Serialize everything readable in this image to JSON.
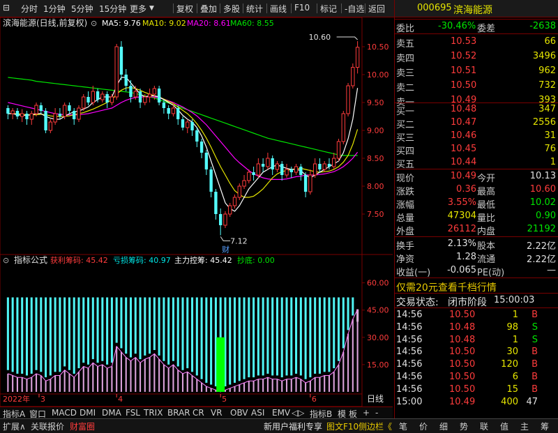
{
  "toolbar": {
    "left_items": [
      "分时",
      "1分钟",
      "5分钟",
      "15分钟",
      "更多"
    ],
    "right_items": [
      "复权",
      "叠加",
      "多股",
      "统计",
      "画线",
      "F10",
      "标记",
      "-自选",
      "返回"
    ]
  },
  "chart": {
    "title": "滨海能源(日线,前复权)",
    "ma": [
      {
        "label": "MA5: 9.76",
        "color": "#ffffff"
      },
      {
        "label": "MA10: 9.02",
        "color": "#e6e600"
      },
      {
        "label": "MA20: 8.61",
        "color": "#ff00ff"
      },
      {
        "label": "MA60: 8.55",
        "color": "#00e600"
      }
    ],
    "price_ticks": [
      "10.50",
      "10.00",
      "9.50",
      "9.00",
      "8.50",
      "8.00",
      "7.50"
    ],
    "high_label": "10.60",
    "low_label": "7.12",
    "low_marker": "财",
    "colors": {
      "up": "#ff3c3c",
      "down": "#54fcfc",
      "ma5": "#ffffff",
      "ma10": "#e6e600",
      "ma20": "#ff00ff",
      "ma60": "#00e600"
    }
  },
  "indicator": {
    "name": "指标公式",
    "items": [
      {
        "label": "获利筹码: 45.42",
        "color": "#ff3c3c"
      },
      {
        "label": "亏损筹码: 40.97",
        "color": "#00e6e6"
      },
      {
        "label": "主力控筹: 45.42",
        "color": "#ffffff"
      },
      {
        "label": "抄底: 0.00",
        "color": "#00e600"
      }
    ],
    "ticks": [
      "60.00",
      "45.00",
      "30.00",
      "15.00"
    ]
  },
  "axis": {
    "year": "2022年",
    "months": [
      "3",
      "4",
      "5",
      "6"
    ],
    "period": "日线"
  },
  "indicator_tabs": [
    "指标A",
    "窗口",
    "MACD",
    "DMI",
    "DMA",
    "FSL",
    "TRIX",
    "BRAR",
    "CR",
    "VR",
    "OBV",
    "ASI",
    "EMV",
    "◁▷",
    "指标B",
    "模",
    "板",
    "+",
    "-"
  ],
  "stock": {
    "code": "000695",
    "name": "滨海能源"
  },
  "weibi": {
    "label": "委比",
    "value": "-30.46%",
    "label2": "委差",
    "value2": "-2638"
  },
  "asks": [
    {
      "label": "卖五",
      "price": "10.53",
      "vol": "66"
    },
    {
      "label": "卖四",
      "price": "10.52",
      "vol": "3496"
    },
    {
      "label": "卖三",
      "price": "10.51",
      "vol": "962"
    },
    {
      "label": "卖二",
      "price": "10.50",
      "vol": "732"
    },
    {
      "label": "卖一",
      "price": "10.49",
      "vol": "393"
    }
  ],
  "bids": [
    {
      "label": "买一",
      "price": "10.48",
      "vol": "347"
    },
    {
      "label": "买二",
      "price": "10.47",
      "vol": "2556"
    },
    {
      "label": "买三",
      "price": "10.46",
      "vol": "31"
    },
    {
      "label": "买四",
      "price": "10.45",
      "vol": "76"
    },
    {
      "label": "买五",
      "price": "10.44",
      "vol": "1"
    }
  ],
  "quote": [
    {
      "l1": "现价",
      "v1": "10.49",
      "c1": "red",
      "l2": "今开",
      "v2": "10.13",
      "c2": "white"
    },
    {
      "l1": "涨跌",
      "v1": "0.36",
      "c1": "red",
      "l2": "最高",
      "v2": "10.60",
      "c2": "red"
    },
    {
      "l1": "涨幅",
      "v1": "3.55%",
      "c1": "red",
      "l2": "最低",
      "v2": "10.02",
      "c2": "green"
    },
    {
      "l1": "总量",
      "v1": "47304",
      "c1": "yellow",
      "l2": "量比",
      "v2": "0.90",
      "c2": "green"
    },
    {
      "l1": "外盘",
      "v1": "26112",
      "c1": "red",
      "l2": "内盘",
      "v2": "21192",
      "c2": "green"
    }
  ],
  "stats": [
    {
      "l1": "换手",
      "v1": "2.13%",
      "l2": "股本",
      "v2": "2.22亿"
    },
    {
      "l1": "净资",
      "v1": "1.28",
      "l2": "流通",
      "v2": "2.22亿"
    },
    {
      "l1": "收益(一)",
      "v1": "-0.065",
      "l2": "PE(动)",
      "v2": "—"
    }
  ],
  "promo": "仅需20元查看千档行情",
  "trade_status": {
    "label": "交易状态:",
    "status": "闭市阶段",
    "time": "15:00:03"
  },
  "ticks_list": [
    {
      "t": "14:56",
      "p": "10.50",
      "v": "1",
      "s": "B"
    },
    {
      "t": "14:56",
      "p": "10.48",
      "v": "98",
      "s": "S"
    },
    {
      "t": "14:56",
      "p": "10.48",
      "v": "1",
      "s": "S"
    },
    {
      "t": "14:56",
      "p": "10.50",
      "v": "30",
      "s": "B"
    },
    {
      "t": "14:56",
      "p": "10.50",
      "v": "120",
      "s": "B"
    },
    {
      "t": "14:56",
      "p": "10.50",
      "v": "6",
      "s": "B"
    },
    {
      "t": "14:56",
      "p": "10.50",
      "v": "15",
      "s": "B"
    },
    {
      "t": "15:00",
      "p": "10.49",
      "v": "400",
      "s": "47"
    }
  ],
  "bottom": {
    "left": [
      "扩展∧",
      "关联报价",
      "财富圈"
    ],
    "middle": [
      "新用户福利专享",
      "图文F10",
      "侧边栏《"
    ],
    "right": [
      "笔",
      "价",
      "细",
      "势",
      "联",
      "值",
      "主",
      "筹"
    ]
  },
  "series": {
    "candles": [
      [
        9.4,
        9.3,
        9.45,
        9.2
      ],
      [
        9.3,
        9.35,
        9.4,
        9.2
      ],
      [
        9.35,
        9.25,
        9.4,
        9.2
      ],
      [
        9.25,
        9.3,
        9.38,
        9.15
      ],
      [
        9.3,
        9.2,
        9.35,
        9.1
      ],
      [
        9.2,
        9.3,
        9.35,
        9.1
      ],
      [
        9.3,
        9.45,
        9.5,
        9.25
      ],
      [
        9.45,
        9.35,
        9.5,
        9.3
      ],
      [
        9.35,
        9.0,
        9.4,
        8.95
      ],
      [
        9.0,
        9.15,
        9.2,
        8.95
      ],
      [
        9.15,
        9.3,
        9.4,
        9.1
      ],
      [
        9.3,
        9.25,
        9.4,
        9.2
      ],
      [
        9.25,
        9.45,
        9.5,
        9.2
      ],
      [
        9.45,
        9.35,
        9.5,
        9.3
      ],
      [
        9.35,
        9.2,
        9.4,
        9.1
      ],
      [
        9.2,
        9.4,
        9.45,
        9.15
      ],
      [
        9.4,
        9.6,
        9.65,
        9.35
      ],
      [
        9.6,
        9.5,
        9.7,
        9.45
      ],
      [
        9.5,
        9.7,
        9.8,
        9.45
      ],
      [
        9.7,
        9.55,
        9.75,
        9.5
      ],
      [
        9.55,
        9.65,
        9.7,
        9.5
      ],
      [
        9.65,
        9.5,
        9.7,
        9.4
      ],
      [
        9.5,
        9.6,
        9.65,
        9.45
      ],
      [
        9.6,
        10.5,
        10.55,
        9.55
      ],
      [
        10.5,
        10.0,
        10.6,
        9.9
      ],
      [
        10.0,
        9.8,
        10.1,
        9.7
      ],
      [
        9.8,
        9.6,
        9.9,
        9.5
      ],
      [
        9.6,
        9.7,
        9.8,
        9.55
      ],
      [
        9.7,
        9.5,
        9.75,
        9.4
      ],
      [
        9.5,
        9.6,
        9.65,
        9.45
      ],
      [
        9.6,
        9.65,
        9.75,
        9.5
      ],
      [
        9.65,
        9.75,
        9.8,
        9.55
      ],
      [
        9.75,
        9.5,
        9.8,
        9.45
      ],
      [
        9.5,
        9.4,
        9.55,
        9.3
      ],
      [
        9.4,
        9.3,
        9.45,
        9.2
      ],
      [
        9.3,
        9.4,
        9.5,
        9.25
      ],
      [
        9.4,
        9.2,
        9.45,
        9.1
      ],
      [
        9.2,
        9.05,
        9.25,
        9.0
      ],
      [
        9.05,
        9.15,
        9.2,
        8.95
      ],
      [
        9.15,
        9.0,
        9.2,
        8.9
      ],
      [
        9.0,
        8.8,
        9.05,
        8.7
      ],
      [
        8.8,
        8.6,
        8.85,
        8.5
      ],
      [
        8.6,
        8.3,
        8.65,
        8.2
      ],
      [
        8.3,
        7.9,
        8.35,
        7.8
      ],
      [
        7.9,
        7.5,
        7.95,
        7.4
      ],
      [
        7.5,
        7.3,
        7.6,
        7.12
      ],
      [
        7.3,
        7.5,
        7.55,
        7.25
      ],
      [
        7.5,
        7.65,
        7.7,
        7.45
      ],
      [
        7.65,
        7.8,
        7.85,
        7.6
      ],
      [
        7.8,
        8.0,
        8.05,
        7.75
      ],
      [
        8.0,
        8.1,
        8.2,
        7.95
      ],
      [
        8.1,
        8.25,
        8.3,
        8.05
      ],
      [
        8.25,
        8.2,
        8.35,
        8.1
      ],
      [
        8.2,
        8.4,
        8.5,
        8.15
      ],
      [
        8.4,
        8.35,
        8.5,
        8.25
      ],
      [
        8.35,
        8.5,
        8.6,
        8.3
      ],
      [
        8.5,
        8.3,
        8.55,
        8.2
      ],
      [
        8.3,
        8.4,
        8.45,
        8.25
      ],
      [
        8.4,
        8.2,
        8.45,
        8.1
      ],
      [
        8.2,
        8.3,
        8.4,
        8.15
      ],
      [
        8.3,
        8.25,
        8.35,
        8.15
      ],
      [
        8.25,
        8.35,
        8.4,
        8.2
      ],
      [
        8.35,
        8.2,
        8.4,
        8.1
      ],
      [
        8.2,
        7.9,
        8.25,
        7.8
      ],
      [
        7.9,
        8.2,
        8.3,
        7.85
      ],
      [
        8.2,
        8.4,
        8.5,
        8.15
      ],
      [
        8.4,
        8.3,
        8.5,
        8.25
      ],
      [
        8.3,
        8.4,
        8.45,
        8.25
      ],
      [
        8.4,
        8.35,
        8.5,
        8.3
      ],
      [
        8.35,
        8.5,
        8.6,
        8.3
      ],
      [
        8.5,
        8.8,
        8.85,
        8.45
      ],
      [
        8.8,
        9.3,
        9.35,
        8.75
      ],
      [
        9.3,
        9.8,
        9.85,
        9.25
      ],
      [
        9.8,
        10.13,
        10.2,
        9.75
      ],
      [
        10.13,
        10.49,
        10.6,
        10.02
      ]
    ],
    "ma5": [
      9.3,
      9.3,
      9.28,
      9.27,
      9.27,
      9.28,
      9.3,
      9.3,
      9.25,
      9.22,
      9.2,
      9.2,
      9.25,
      9.3,
      9.33,
      9.35,
      9.38,
      9.42,
      9.5,
      9.55,
      9.6,
      9.6,
      9.6,
      9.8,
      9.95,
      9.95,
      9.85,
      9.75,
      9.65,
      9.6,
      9.62,
      9.62,
      9.6,
      9.55,
      9.5,
      9.45,
      9.37,
      9.27,
      9.2,
      9.15,
      9.05,
      8.9,
      8.7,
      8.45,
      8.2,
      7.95,
      7.7,
      7.6,
      7.55,
      7.65,
      7.8,
      7.95,
      8.05,
      8.15,
      8.25,
      8.3,
      8.35,
      8.38,
      8.35,
      8.32,
      8.3,
      8.3,
      8.28,
      8.2,
      8.15,
      8.2,
      8.25,
      8.3,
      8.35,
      8.4,
      8.45,
      8.6,
      8.85,
      9.2,
      9.76
    ],
    "ma10": [
      9.3,
      9.3,
      9.3,
      9.29,
      9.28,
      9.28,
      9.28,
      9.29,
      9.28,
      9.26,
      9.25,
      9.25,
      9.25,
      9.26,
      9.28,
      9.3,
      9.32,
      9.35,
      9.38,
      9.42,
      9.46,
      9.5,
      9.55,
      9.65,
      9.72,
      9.76,
      9.77,
      9.75,
      9.72,
      9.68,
      9.65,
      9.62,
      9.6,
      9.56,
      9.52,
      9.48,
      9.42,
      9.36,
      9.3,
      9.22,
      9.12,
      9.0,
      8.86,
      8.7,
      8.52,
      8.35,
      8.2,
      8.05,
      7.92,
      7.85,
      7.8,
      7.8,
      7.82,
      7.88,
      7.95,
      8.05,
      8.15,
      8.22,
      8.26,
      8.28,
      8.3,
      8.31,
      8.32,
      8.3,
      8.28,
      8.26,
      8.25,
      8.26,
      8.27,
      8.3,
      8.35,
      8.43,
      8.55,
      8.75,
      9.02
    ],
    "ma20": [
      9.5,
      9.48,
      9.46,
      9.44,
      9.42,
      9.4,
      9.38,
      9.36,
      9.34,
      9.32,
      9.3,
      9.29,
      9.28,
      9.28,
      9.28,
      9.28,
      9.29,
      9.3,
      9.32,
      9.34,
      9.36,
      9.38,
      9.4,
      9.45,
      9.5,
      9.54,
      9.57,
      9.59,
      9.6,
      9.6,
      9.6,
      9.6,
      9.58,
      9.56,
      9.53,
      9.5,
      9.46,
      9.42,
      9.37,
      9.32,
      9.26,
      9.18,
      9.1,
      9.0,
      8.9,
      8.8,
      8.7,
      8.6,
      8.5,
      8.42,
      8.35,
      8.28,
      8.22,
      8.18,
      8.15,
      8.13,
      8.12,
      8.12,
      8.12,
      8.13,
      8.15,
      8.17,
      8.18,
      8.2,
      8.2,
      8.2,
      8.21,
      8.22,
      8.24,
      8.26,
      8.3,
      8.35,
      8.42,
      8.5,
      8.61
    ],
    "ma60": [
      9.95,
      9.94,
      9.93,
      9.92,
      9.91,
      9.9,
      9.88,
      9.87,
      9.86,
      9.85,
      9.84,
      9.83,
      9.82,
      9.81,
      9.8,
      9.79,
      9.78,
      9.77,
      9.76,
      9.75,
      9.74,
      9.73,
      9.72,
      9.71,
      9.7,
      9.69,
      9.68,
      9.66,
      9.64,
      9.62,
      9.6,
      9.58,
      9.55,
      9.52,
      9.49,
      9.46,
      9.43,
      9.4,
      9.37,
      9.34,
      9.31,
      9.28,
      9.25,
      9.22,
      9.19,
      9.16,
      9.13,
      9.1,
      9.07,
      9.04,
      9.01,
      8.98,
      8.95,
      8.92,
      8.89,
      8.86,
      8.84,
      8.82,
      8.8,
      8.78,
      8.76,
      8.74,
      8.72,
      8.7,
      8.68,
      8.66,
      8.64,
      8.62,
      8.6,
      8.58,
      8.56,
      8.55,
      8.55,
      8.55,
      8.55
    ],
    "profit": [
      10,
      9,
      8,
      8,
      7,
      8,
      10,
      9,
      6,
      7,
      9,
      9,
      12,
      10,
      8,
      11,
      14,
      13,
      16,
      14,
      15,
      13,
      14,
      25,
      22,
      19,
      17,
      19,
      16,
      18,
      19,
      21,
      18,
      15,
      13,
      15,
      12,
      10,
      11,
      9,
      7,
      5,
      3,
      2,
      1,
      0,
      1,
      2,
      3,
      4,
      5,
      6,
      6,
      7,
      7,
      8,
      7,
      7,
      6,
      7,
      7,
      8,
      7,
      5,
      6,
      8,
      8,
      9,
      9,
      11,
      15,
      22,
      32,
      40,
      45.42
    ],
    "loss": [
      40,
      41,
      42,
      42,
      43,
      42,
      40,
      41,
      44,
      43,
      41,
      41,
      38,
      40,
      42,
      39,
      36,
      37,
      34,
      36,
      35,
      37,
      36,
      25,
      28,
      31,
      33,
      31,
      34,
      32,
      31,
      29,
      32,
      35,
      37,
      35,
      38,
      40,
      39,
      41,
      43,
      45,
      47,
      48,
      49,
      50,
      49,
      48,
      47,
      46,
      45,
      44,
      44,
      43,
      43,
      42,
      43,
      43,
      44,
      43,
      43,
      42,
      43,
      45,
      44,
      42,
      42,
      41,
      41,
      39,
      35,
      28,
      18,
      10,
      40.97
    ],
    "main": [
      52,
      52,
      52,
      52,
      52,
      52,
      52,
      52,
      52,
      52,
      52,
      52,
      52,
      52,
      52,
      52,
      52,
      52,
      52,
      52,
      52,
      52,
      52,
      52,
      52,
      52,
      52,
      52,
      52,
      52,
      52,
      52,
      52,
      52,
      52,
      52,
      52,
      52,
      52,
      52,
      52,
      52,
      52,
      52,
      52,
      52,
      52,
      52,
      52,
      52,
      52,
      52,
      52,
      52,
      52,
      52,
      52,
      52,
      52,
      52,
      52,
      52,
      52,
      52,
      52,
      52,
      52,
      52,
      52,
      52,
      52,
      52,
      52,
      52,
      45.42
    ],
    "dip_index": 45,
    "dip_value": 30
  }
}
